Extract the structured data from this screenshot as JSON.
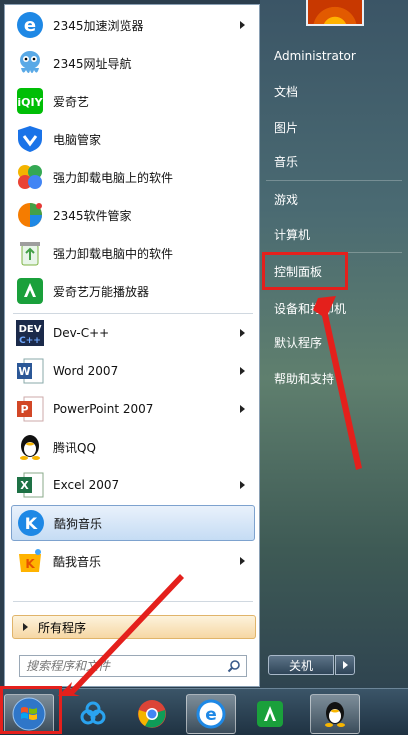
{
  "programs": [
    {
      "label": "2345加速浏览器",
      "icon": "ie-blue-e-icon",
      "has_submenu": true
    },
    {
      "label": "2345网址导航",
      "icon": "octopus-mascot-icon",
      "has_submenu": false
    },
    {
      "label": "爱奇艺",
      "icon": "iqiyi-icon",
      "has_submenu": false
    },
    {
      "label": "电脑管家",
      "icon": "shield-icon",
      "has_submenu": false
    },
    {
      "label": "强力卸载电脑上的软件",
      "icon": "clover-icon",
      "has_submenu": false
    },
    {
      "label": "2345软件管家",
      "icon": "software-manager-icon",
      "has_submenu": false
    },
    {
      "label": "强力卸载电脑中的软件",
      "icon": "recycle-bin-icon",
      "has_submenu": false
    },
    {
      "label": "爱奇艺万能播放器",
      "icon": "iqiyi-player-icon",
      "has_submenu": false
    },
    {
      "label": "Dev-C++",
      "icon": "devcpp-icon",
      "has_submenu": true
    },
    {
      "label": "Word 2007",
      "icon": "word-icon",
      "has_submenu": true
    },
    {
      "label": "PowerPoint 2007",
      "icon": "powerpoint-icon",
      "has_submenu": true
    },
    {
      "label": "腾讯QQ",
      "icon": "qq-penguin-icon",
      "has_submenu": false
    },
    {
      "label": "Excel 2007",
      "icon": "excel-icon",
      "has_submenu": true
    },
    {
      "label": "酷狗音乐",
      "icon": "kugou-icon",
      "has_submenu": false,
      "selected": true
    },
    {
      "label": "酷我音乐",
      "icon": "kuwo-icon",
      "has_submenu": true
    }
  ],
  "all_programs": "所有程序",
  "search": {
    "placeholder": "搜索程序和文件"
  },
  "right_items": [
    {
      "label": "Administrator"
    },
    {
      "label": "文档"
    },
    {
      "label": "图片"
    },
    {
      "label": "音乐"
    },
    {
      "label": "游戏"
    },
    {
      "label": "计算机"
    },
    {
      "label": "控制面板"
    },
    {
      "label": "设备和打印机"
    },
    {
      "label": "默认程序"
    },
    {
      "label": "帮助和支持"
    }
  ],
  "shutdown_label": "关机",
  "taskbar": [
    {
      "name": "start-button",
      "icon": "windows-logo-icon"
    },
    {
      "name": "baidu-netdisk",
      "icon": "cloud-icon"
    },
    {
      "name": "chrome",
      "icon": "chrome-icon"
    },
    {
      "name": "ie-browser",
      "icon": "ie-icon"
    },
    {
      "name": "iqiyi-player",
      "icon": "iqiyi-player-icon"
    },
    {
      "name": "qq",
      "icon": "qq-penguin-icon"
    }
  ],
  "colors": {
    "highlight_red": "#e4201c",
    "accent_blue": "#1e88e5"
  }
}
